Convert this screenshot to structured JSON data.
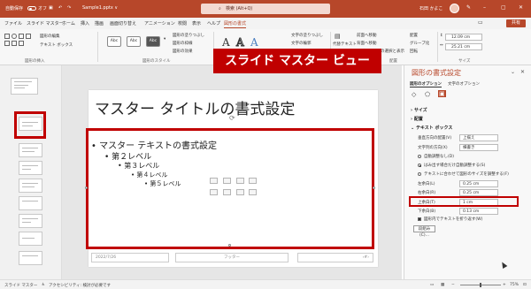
{
  "titlebar": {
    "autosave": "自動保存",
    "autosave_state": "オフ",
    "filename": "Sample1.pptx ∨",
    "search": "検索 (Alt+Q)",
    "user": "石田 かよこ",
    "search_icon": "search-icon"
  },
  "menu": {
    "tabs": [
      "ファイル",
      "スライド マスター",
      "ホーム",
      "挿入",
      "描画",
      "画面切り替え",
      "アニメーション",
      "校閲",
      "表示",
      "ヘルプ",
      "図形の書式"
    ],
    "share": "共有"
  },
  "ribbon": {
    "insert_shapes_label": "図形の挿入",
    "edit_shape": "図形の編集",
    "textbox": "テキスト ボックス",
    "style_swatches": [
      "Abc",
      "Abc",
      "Abc"
    ],
    "fill": "図形の塗りつぶし",
    "outline": "図形の枠線",
    "effects": "図形の効果",
    "styles_label": "図形のスタイル",
    "text_fill": "文字の塗りつぶし",
    "text_outline": "文字の輪郭",
    "text_effects": "文字の効果",
    "alt_text": "代替テキスト",
    "bring_forward": "前面へ移動",
    "send_backward": "背面へ移動",
    "selection_pane": "オブジェクトの選択と表示",
    "align": "配置",
    "group": "グループ化",
    "rotate": "回転",
    "arrange_label": "配置",
    "height": "12.09 cm",
    "width": "25.21 cm",
    "size_label": "サイズ"
  },
  "banner": "スライド マスター ビュー",
  "slide": {
    "title": "マスター タイトルの書式設定",
    "bullets": [
      "• マスター テキストの書式設定",
      "• 第２レベル",
      "• 第３レベル",
      "• 第４レベル",
      "• 第５レベル"
    ],
    "footer_date": "2022/7/26",
    "footer_text": "フッター",
    "footer_num": "‹#›"
  },
  "format_pane": {
    "title": "図形の書式設定",
    "tab_shape": "図形のオプション",
    "tab_text": "文字のオプション",
    "section_size": "サイズ",
    "section_props": "配置",
    "section_textbox": "テキスト ボックス",
    "valign_label": "垂直方向の配置(V)",
    "valign_value": "上揃え",
    "textdir_label": "文字列の方向(X)",
    "textdir_value": "横書き",
    "autofit_off": "自動調整なし(D)",
    "autofit_shrink": "はみ出す場合だけ自動調整する(S)",
    "autofit_resize": "テキストに合わせて図形のサイズを調整する(F)",
    "left_label": "左余白(L)",
    "left_value": "0.25 cm",
    "right_label": "右余白(R)",
    "right_value": "0.25 cm",
    "top_label": "上余白(T)",
    "top_value": "1 cm",
    "bottom_label": "下余白(B)",
    "bottom_value": "0.13 cm",
    "wrap_label": "図形内でテキストを折り返す(W)",
    "columns_button": "段組み(C)..."
  },
  "status": {
    "view": "スライド マスター",
    "accessibility": "アクセシビリティ: 検討が必要です",
    "zoom": "75%"
  }
}
